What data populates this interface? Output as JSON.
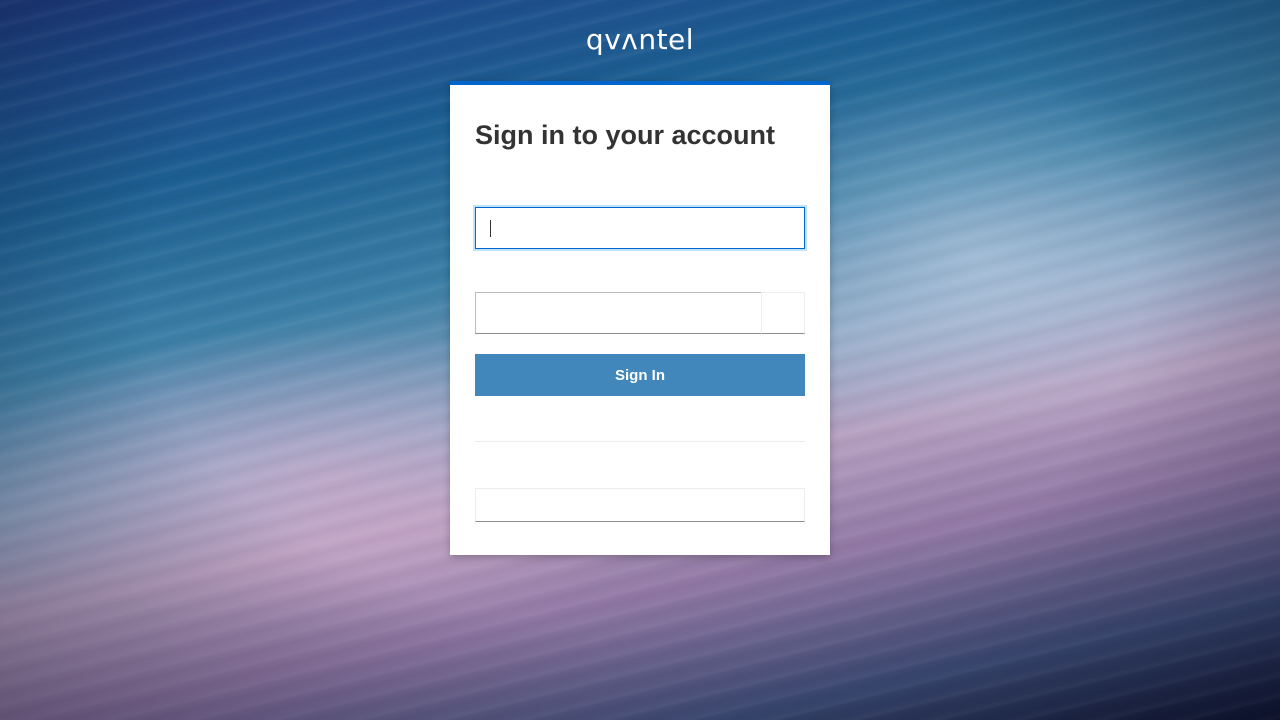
{
  "brand": {
    "logo_text": "qvʌntel"
  },
  "login": {
    "title": "Sign in to your account",
    "username_value": "",
    "password_value": "",
    "signin_label": "Sign In"
  },
  "colors": {
    "accent_top_border": "#0066cc",
    "signin_button": "#4287bb",
    "title_text": "#333333"
  }
}
